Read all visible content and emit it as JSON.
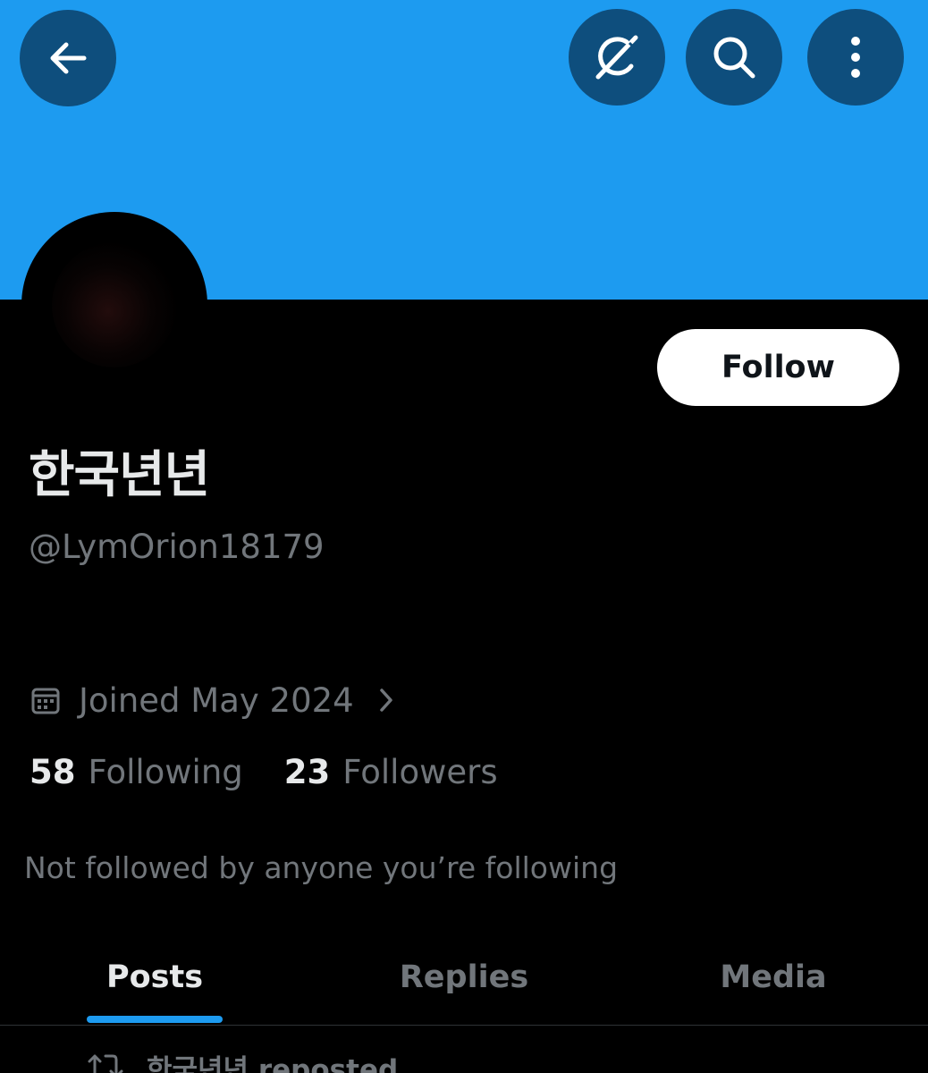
{
  "profile": {
    "display_name": "한국년년",
    "handle": "@LymOrion18179",
    "joined": "Joined May 2024",
    "follow_label": "Follow"
  },
  "stats": {
    "following_count": "58",
    "following_label": "Following",
    "followers_count": "23",
    "followers_label": "Followers"
  },
  "social_context": "Not followed by anyone you’re following",
  "tabs": [
    {
      "label": "Posts",
      "active": true
    },
    {
      "label": "Replies",
      "active": false
    },
    {
      "label": "Media",
      "active": false
    }
  ],
  "feed": {
    "repost_label": "한국년년 reposted"
  },
  "header_icons": [
    "back-arrow-icon",
    "grok-icon",
    "search-icon",
    "more-vertical-icon"
  ],
  "colors": {
    "banner": "#1d9bf0",
    "header_button": "#0e4e7d",
    "accent": "#1d9bf0",
    "background": "#000000",
    "primary_text": "#e7e9ea",
    "secondary_text": "#71767b"
  }
}
